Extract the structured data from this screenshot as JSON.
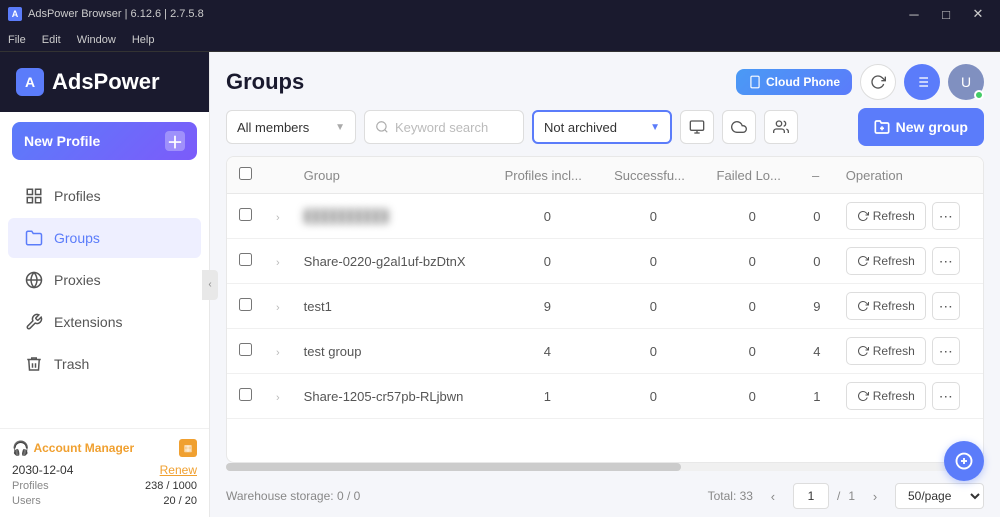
{
  "titleBar": {
    "appName": "AdsPower Browser",
    "version": "6.12.6 | 2.7.5.8"
  },
  "menuBar": {
    "items": [
      "File",
      "Edit",
      "Window",
      "Help"
    ]
  },
  "sidebar": {
    "logoText": "AdsPower",
    "newProfileLabel": "New Profile",
    "navItems": [
      {
        "id": "profiles",
        "label": "Profiles",
        "icon": "🗂"
      },
      {
        "id": "groups",
        "label": "Groups",
        "icon": "📁"
      },
      {
        "id": "proxies",
        "label": "Proxies",
        "icon": "🌐"
      },
      {
        "id": "extensions",
        "label": "Extensions",
        "icon": "🔧"
      },
      {
        "id": "trash",
        "label": "Trash",
        "icon": "🗑"
      }
    ],
    "footer": {
      "accountManagerLabel": "Account Manager",
      "date": "2030-12-04",
      "renewLabel": "Renew",
      "profilesLabel": "Profiles",
      "profilesValue": "238 / 1000",
      "usersLabel": "Users",
      "usersValue": "20 / 20"
    }
  },
  "header": {
    "title": "Groups",
    "cloudPhoneLabel": "Cloud Phone",
    "refreshIconTitle": "refresh",
    "listIconTitle": "list",
    "avatarInitial": "U"
  },
  "toolbar": {
    "allMembersLabel": "All members",
    "searchPlaceholder": "Keyword search",
    "archiveLabel": "Not archived",
    "newGroupLabel": "New group"
  },
  "table": {
    "columns": [
      "Group",
      "Profiles incl...",
      "Successfu...",
      "Failed Lo...",
      "–",
      "Operation"
    ],
    "rows": [
      {
        "id": 1,
        "name": "██████████",
        "blurred": true,
        "profiles": 0,
        "success": 0,
        "failed": 0,
        "col5": 0
      },
      {
        "id": 2,
        "name": "Share-0220-g2al1uf-bzDtnX",
        "blurred": false,
        "profiles": 0,
        "success": 0,
        "failed": 0,
        "col5": 0
      },
      {
        "id": 3,
        "name": "test1",
        "blurred": false,
        "profiles": 9,
        "success": 0,
        "failed": 0,
        "col5": 9
      },
      {
        "id": 4,
        "name": "test group",
        "blurred": false,
        "profiles": 4,
        "success": 0,
        "failed": 0,
        "col5": 4
      },
      {
        "id": 5,
        "name": "Share-1205-cr57pb-RLjbwn",
        "blurred": false,
        "profiles": 1,
        "success": 0,
        "failed": 0,
        "col5": 1
      }
    ],
    "operationRefreshLabel": "Refresh",
    "operationMoreLabel": "⋯"
  },
  "footer": {
    "storageLabel": "Warehouse storage: 0 / 0",
    "totalLabel": "Total: 33",
    "currentPage": "1",
    "totalPages": "1",
    "perPageValue": "50/page"
  }
}
